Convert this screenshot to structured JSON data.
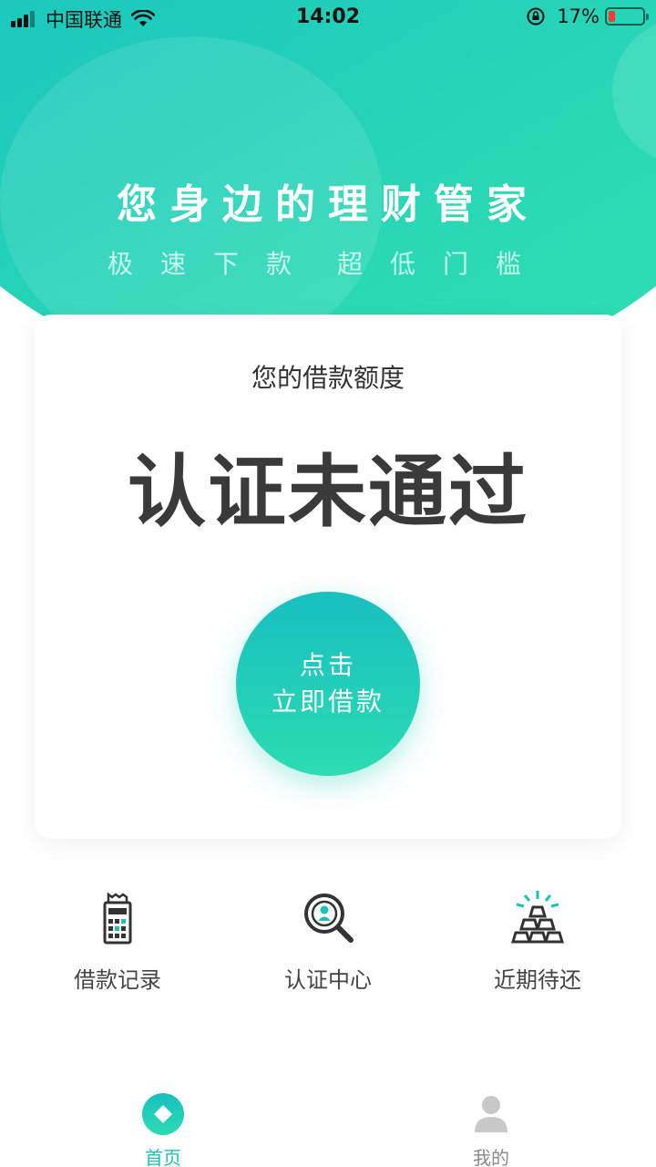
{
  "status_bar": {
    "carrier": "中国联通",
    "time": "14:02",
    "battery_percent": "17%",
    "battery_level": 0.17,
    "icons": [
      "signal-icon",
      "wifi-icon",
      "rotation-lock-icon",
      "battery-icon"
    ]
  },
  "hero": {
    "slogan": "您身边的理财管家",
    "sub_left": "极速下款",
    "sub_right": "超低门槛"
  },
  "card": {
    "label": "您的借款额度",
    "status": "认证未通过",
    "button_line1": "点击",
    "button_line2": "立即借款"
  },
  "actions": [
    {
      "label": "借款记录",
      "icon": "loan-record-icon"
    },
    {
      "label": "认证中心",
      "icon": "verification-search-icon"
    },
    {
      "label": "近期待还",
      "icon": "gold-bars-icon"
    }
  ],
  "tabbar": [
    {
      "label": "首页",
      "icon": "home-diamond-icon",
      "active": true
    },
    {
      "label": "我的",
      "icon": "user-icon",
      "active": false
    }
  ],
  "colors": {
    "accent": "#1cc3b5",
    "gradient_start": "#18c0b8",
    "gradient_end": "#31e0b0",
    "text_dark": "#3a3a3a",
    "battery_low": "#ff3b30"
  }
}
